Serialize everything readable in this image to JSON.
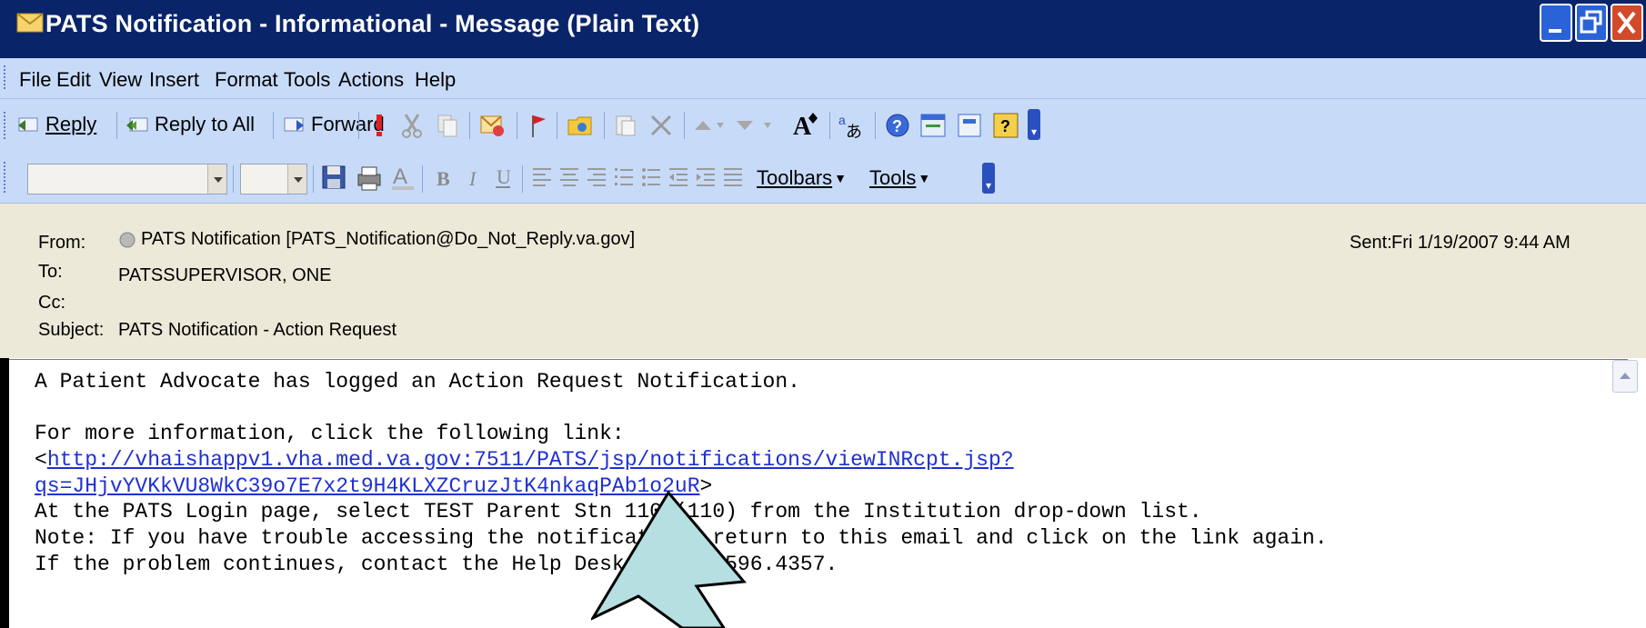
{
  "window": {
    "title": "PATS Notification - Informational - Message (Plain Text)"
  },
  "menu": [
    "File",
    "Edit",
    "View",
    "Insert",
    "Format",
    "Tools",
    "Actions",
    "Help"
  ],
  "toolbar1": {
    "reply": "Reply",
    "reply_all": "Reply to All",
    "forward": "Forward"
  },
  "toolbar2": {
    "toolbars": "Toolbars",
    "tools": "Tools"
  },
  "header": {
    "from_label": "From:",
    "from_value": "PATS Notification [PATS_Notification@Do_Not_Reply.va.gov]",
    "to_label": "To:",
    "to_value": "PATSSUPERVISOR, ONE",
    "cc_label": "Cc:",
    "cc_value": "",
    "subject_label": "Subject:",
    "subject_value": "PATS Notification - Action Request",
    "sent_label": "Sent:",
    "sent_value": "Fri 1/19/2007 9:44 AM"
  },
  "body": {
    "line1": "A Patient Advocate has logged an Action Request Notification.",
    "line2": "For more information, click the following link:",
    "link_open": "<",
    "link_part1": "http://vhaishappv1.vha.med.va.gov:7511/PATS/jsp/notifications/viewINRcpt.jsp?",
    "link_part2": "qs=JHjvYVKkVU8WkC39o7E7x2t9H4KLXZCruzJtK4nkaqPAb1o2uR",
    "link_close": ">",
    "line5": "At the PATS Login page, select TEST Parent Stn 110 (110) from the Institution drop-down list.",
    "line6": "Note: If you have trouble accessing the notification, return to this email and click on the link again.",
    "line7": "If the problem continues, contact the Help Desk at 888.596.4357."
  },
  "colors": {
    "titlebar": "#0a246a",
    "menubar": "#c7dbf9",
    "header_bg": "#ece9d8",
    "link": "#1f2fd4",
    "callout_arrow": "#b5dfe1"
  }
}
